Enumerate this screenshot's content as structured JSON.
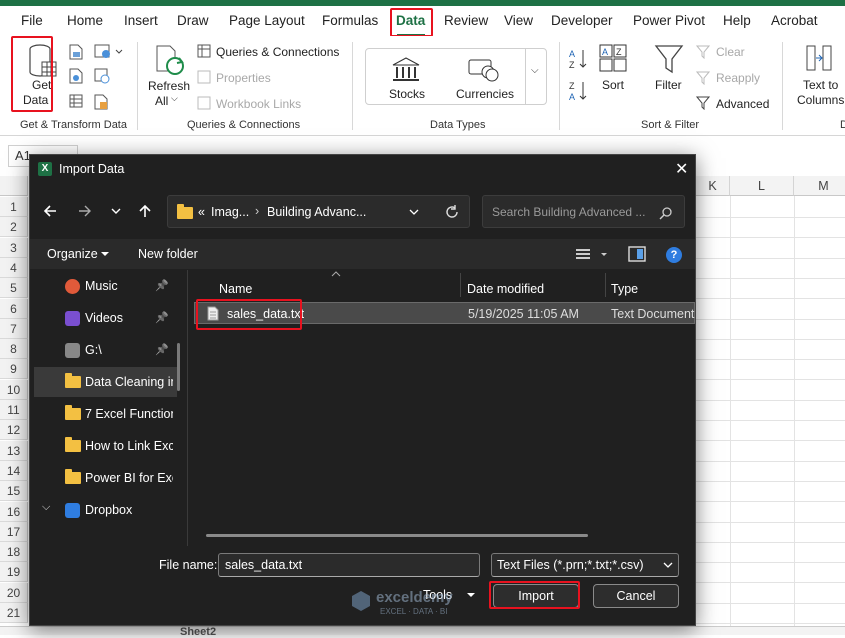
{
  "menu": [
    "File",
    "Home",
    "Insert",
    "Draw",
    "Page Layout",
    "Formulas",
    "Data",
    "Review",
    "View",
    "Developer",
    "Power Pivot",
    "Help",
    "Acrobat"
  ],
  "ribbon": {
    "get_data": [
      "Get",
      "Data"
    ],
    "get_transform_label": "Get & Transform Data",
    "refresh_all": [
      "Refresh",
      "All"
    ],
    "queries_connections": "Queries & Connections",
    "properties": "Properties",
    "workbook_links": "Workbook Links",
    "queries_group_label": "Queries & Connections",
    "stocks": "Stocks",
    "currencies": "Currencies",
    "data_types_label": "Data Types",
    "sort": "Sort",
    "filter": "Filter",
    "clear": "Clear",
    "reapply": "Reapply",
    "advanced": "Advanced",
    "sort_filter_label": "Sort & Filter",
    "text_to_columns": [
      "Text to",
      "Columns"
    ],
    "d_partial": "D"
  },
  "sheet": {
    "namebox": "A1",
    "col_headers": [
      "K",
      "L",
      "M"
    ],
    "row_numbers": [
      "1",
      "2",
      "3",
      "4",
      "5",
      "6",
      "7",
      "8",
      "9",
      "10",
      "11",
      "12",
      "13",
      "14",
      "15",
      "16",
      "17",
      "18",
      "19",
      "20",
      "21"
    ],
    "tab_partial": "Sheet2"
  },
  "dialog": {
    "title": "Import Data",
    "path_prefix": "«",
    "path_1": "Imag...",
    "path_sep": "›",
    "path_2": "Building Advanc...",
    "search_placeholder": "Search Building Advanced ...",
    "organize": "Organize",
    "new_folder": "New folder",
    "nav_items": [
      {
        "label": "Music",
        "icon": "music-icon",
        "pinned": true
      },
      {
        "label": "Videos",
        "icon": "video-icon",
        "pinned": true
      },
      {
        "label": "G:\\",
        "icon": "drive-icon",
        "pinned": true
      },
      {
        "label": "Data Cleaning in",
        "icon": "folder-icon",
        "pinned": false
      },
      {
        "label": "7 Excel Function",
        "icon": "folder-icon",
        "pinned": false
      },
      {
        "label": "How to Link Exc",
        "icon": "folder-icon",
        "pinned": false
      },
      {
        "label": "Power BI for Exc",
        "icon": "folder-icon",
        "pinned": false
      },
      {
        "label": "Dropbox",
        "icon": "dropbox-icon",
        "pinned": false
      }
    ],
    "columns": [
      "Name",
      "Date modified",
      "Type"
    ],
    "files": [
      {
        "name": "sales_data.txt",
        "date": "5/19/2025 11:05 AM",
        "type": "Text Document"
      }
    ],
    "file_name_label": "File name:",
    "file_name_value": "sales_data.txt",
    "file_type_value": "Text Files (*.prn;*.txt;*.csv)",
    "tools": "Tools",
    "import": "Import",
    "cancel": "Cancel"
  },
  "watermark": {
    "name": "exceldemy",
    "tagline": "EXCEL · DATA · BI"
  },
  "colors": {
    "excel_green": "#1e7145",
    "highlight_red": "#e8121f",
    "dialog_bg": "#202020",
    "selected_row": "#4a4a4a"
  }
}
